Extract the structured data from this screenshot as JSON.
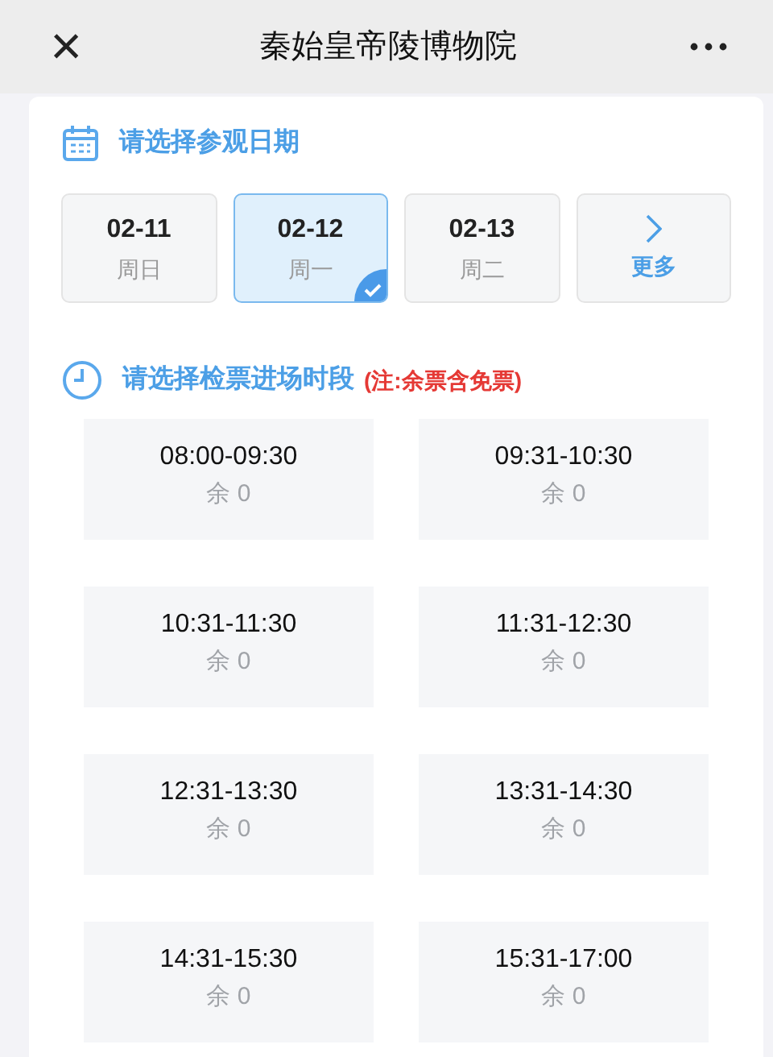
{
  "header": {
    "title": "秦始皇帝陵博物院",
    "close": "×"
  },
  "date_section": {
    "title": "请选择参观日期",
    "dates": [
      {
        "date": "02-11",
        "weekday": "周日",
        "selected": false
      },
      {
        "date": "02-12",
        "weekday": "周一",
        "selected": true
      },
      {
        "date": "02-13",
        "weekday": "周二",
        "selected": false
      }
    ],
    "more": "更多"
  },
  "time_section": {
    "title": "请选择检票进场时段",
    "note": "(注:余票含免票)",
    "slots": [
      {
        "time": "08:00-09:30",
        "remaining": "余 0"
      },
      {
        "time": "09:31-10:30",
        "remaining": "余 0"
      },
      {
        "time": "10:31-11:30",
        "remaining": "余 0"
      },
      {
        "time": "11:31-12:30",
        "remaining": "余 0"
      },
      {
        "time": "12:31-13:30",
        "remaining": "余 0"
      },
      {
        "time": "13:31-14:30",
        "remaining": "余 0"
      },
      {
        "time": "14:31-15:30",
        "remaining": "余 0"
      },
      {
        "time": "15:31-17:00",
        "remaining": "余 0"
      }
    ]
  }
}
